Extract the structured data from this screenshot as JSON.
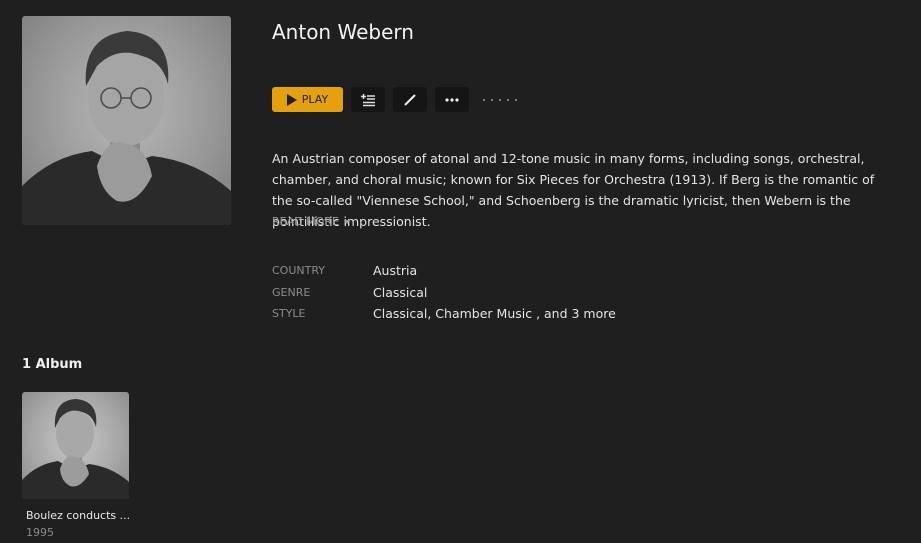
{
  "artist": {
    "name": "Anton Webern",
    "description": "An Austrian composer of atonal and 12-tone music in many forms, including songs, orchestral, chamber, and choral music; known for Six Pieces for Orchestra (1913). If Berg is the romantic of the so-called \"Viennese School,\" and Schoenberg is the dramatic lyricist, then Webern is the pointillistic impressionist.",
    "read_more_label": "READ MORE"
  },
  "toolbar": {
    "play_label": "PLAY",
    "add_to_queue_icon": "add-to-queue-icon",
    "edit_icon": "pencil-icon",
    "more_icon": "more-horizontal-icon",
    "accent_color": "#e5a00d"
  },
  "metadata": [
    {
      "label": "COUNTRY",
      "value": "Austria"
    },
    {
      "label": "GENRE",
      "value": "Classical"
    },
    {
      "label": "STYLE",
      "value": "Classical, Chamber Music , and 3 more"
    }
  ],
  "albums_section": {
    "heading": "1 Album",
    "albums": [
      {
        "title": "Boulez conducts ...",
        "year": "1995"
      }
    ]
  }
}
